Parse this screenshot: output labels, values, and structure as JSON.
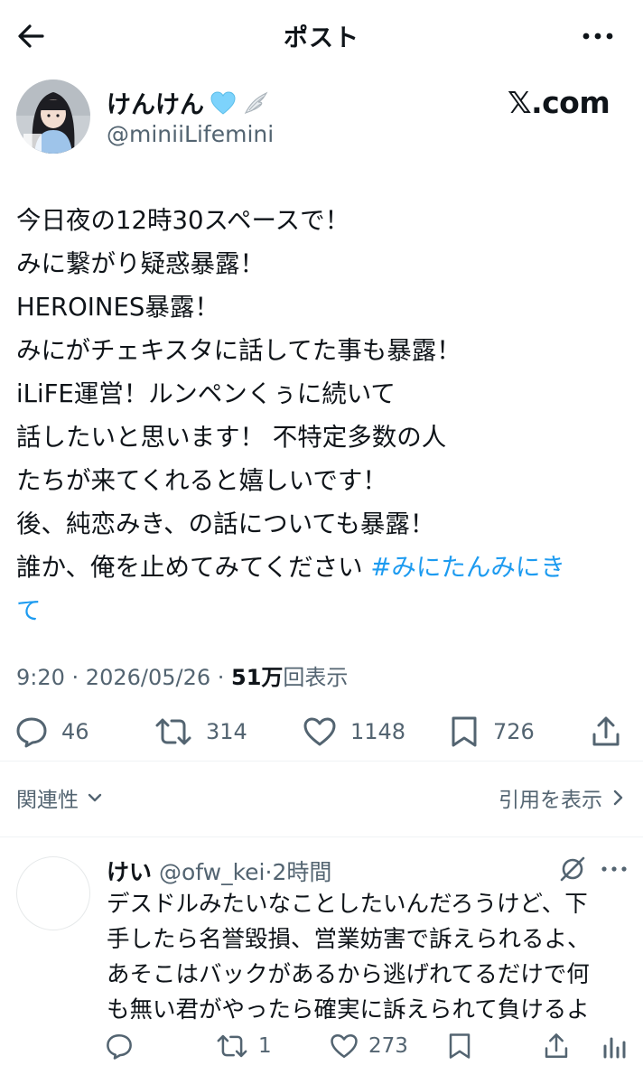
{
  "header": {
    "title": "ポスト"
  },
  "post": {
    "author": {
      "name": "けんけん",
      "handle": "@miniiLifemini"
    },
    "watermark": "𝕏.com",
    "lines": [
      "今日夜の12時30スペースで！",
      "みに繋がり疑惑暴露！",
      "HEROINES暴露！",
      "みにがチェキスタに話してた事も暴露！",
      "iLiFE運営！ルンペンくぅに続いて",
      "話したいと思います！ 不特定多数の人",
      "たちが来てくれると嬉しいです！",
      "後、純恋みき、の話についても暴露！"
    ],
    "last_line_text": "誰か、俺を止めてみてください ",
    "hashtag_part1": "#みにたんみにき",
    "hashtag_part2": "て",
    "time": "9:20",
    "date": "2026/05/26",
    "dot": " · ",
    "views_count": "51万",
    "views_label": "回表示",
    "stats": {
      "replies": "46",
      "reposts": "314",
      "likes": "1148",
      "bookmarks": "726"
    }
  },
  "footer_links": {
    "related": "関連性",
    "quotes": "引用を表示"
  },
  "reply": {
    "name": "けい",
    "handle": "@ofw_kei",
    "time": "2時間",
    "dot": "·",
    "lines": [
      "デスドルみたいなことしたいんだろうけど、下",
      "手したら名誉毀損、営業妨害で訴えられるよ、",
      "あそこはバックがあるから逃げれてるだけで何",
      "も無い君がやったら確実に訴えられて負けるよ"
    ],
    "stats": {
      "reposts": "1",
      "likes": "273"
    }
  },
  "colors": {
    "accent": "#1d9bf0",
    "text": "#0f1419",
    "muted": "#536471",
    "badge_heart": "#7dd3fc"
  },
  "icons": [
    "back-arrow-icon",
    "more-icon",
    "heart-badge-icon",
    "wing-icon",
    "reply-icon",
    "repost-icon",
    "like-icon",
    "bookmark-icon",
    "share-icon",
    "chevron-down-icon",
    "chevron-right-icon",
    "grok-icon"
  ]
}
